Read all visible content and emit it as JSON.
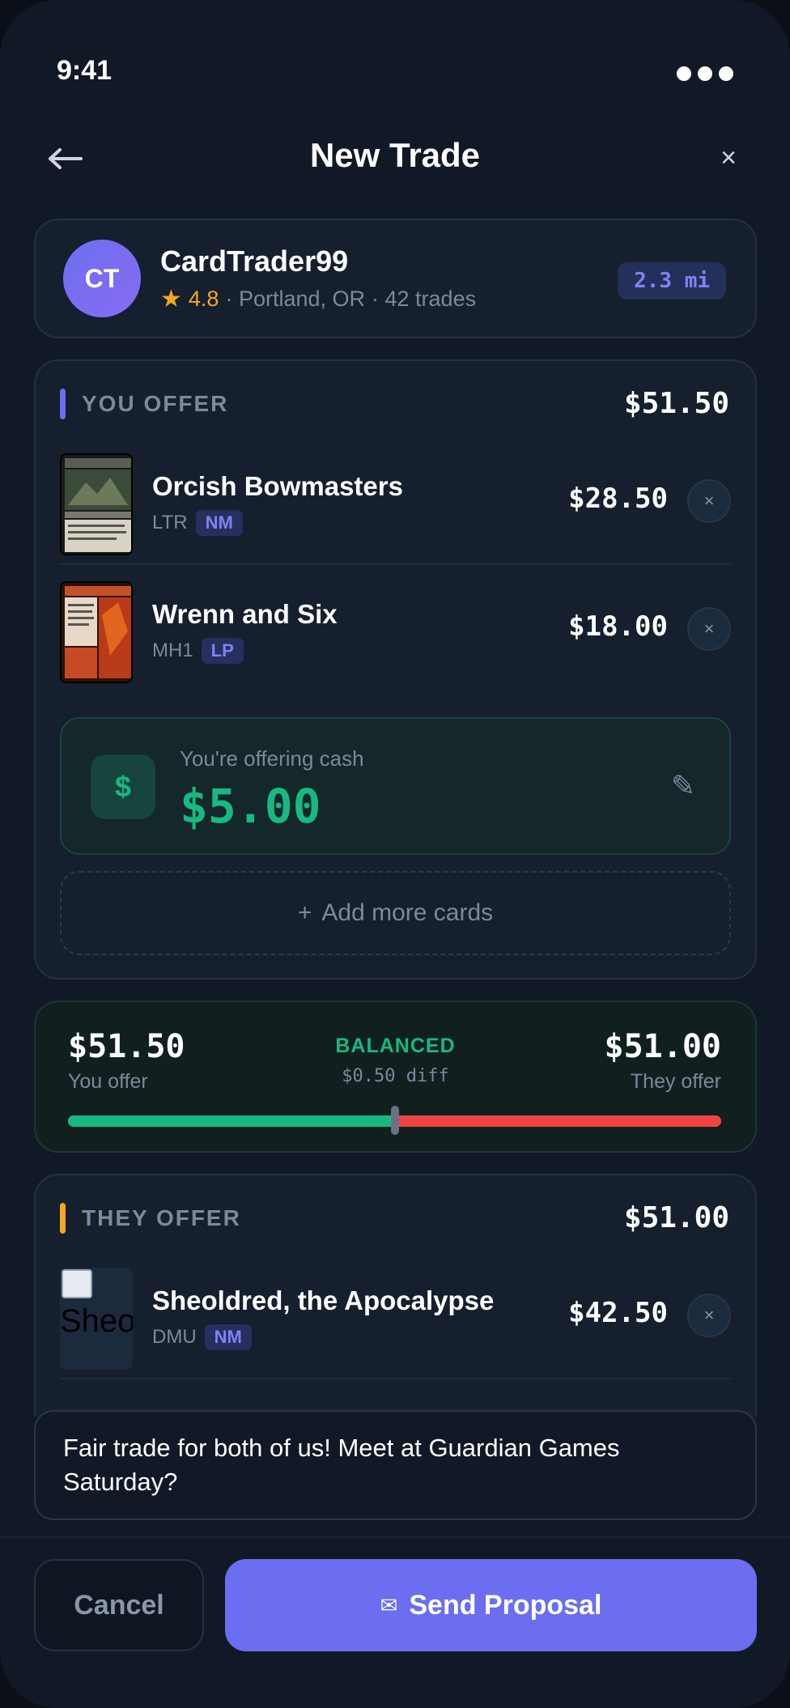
{
  "status_bar": {
    "time": "9:41"
  },
  "header": {
    "title": "New Trade",
    "close_glyph": "×"
  },
  "trader": {
    "initials": "CT",
    "name": "CardTrader99",
    "rating": "4.8",
    "location": "· Portland, OR",
    "trades": "· 42 trades",
    "distance": "2.3 mi"
  },
  "you_offer": {
    "label": "YOU OFFER",
    "total": "$51.50",
    "accent": "#6b6ef0",
    "cards": [
      {
        "name": "Orcish Bowmasters",
        "set": "LTR",
        "condition": "NM",
        "price": "$28.50"
      },
      {
        "name": "Wrenn and Six",
        "set": "MH1",
        "condition": "LP",
        "price": "$18.00"
      }
    ],
    "cash": {
      "label": "You're offering cash",
      "amount": "$5.00",
      "icon": "$"
    },
    "add_more": {
      "icon": "+",
      "label": "Add more cards"
    }
  },
  "balance": {
    "you_amount": "$51.50",
    "you_label": "You offer",
    "status": "BALANCED",
    "diff": "$0.50 diff",
    "they_amount": "$51.00",
    "they_label": "They offer",
    "you_share": 0.5
  },
  "they_offer": {
    "label": "THEY OFFER",
    "total": "$51.00",
    "accent": "#f5a623",
    "cards": [
      {
        "name": "Sheoldred, the Apocalypse",
        "set": "DMU",
        "condition": "NM",
        "price": "$42.50",
        "image_alt": "Sheo"
      }
    ]
  },
  "message": "Fair trade for both of us! Meet at Guardian Games Saturday?",
  "actions": {
    "cancel": "Cancel",
    "send": "Send Proposal",
    "remove_glyph": "×"
  }
}
